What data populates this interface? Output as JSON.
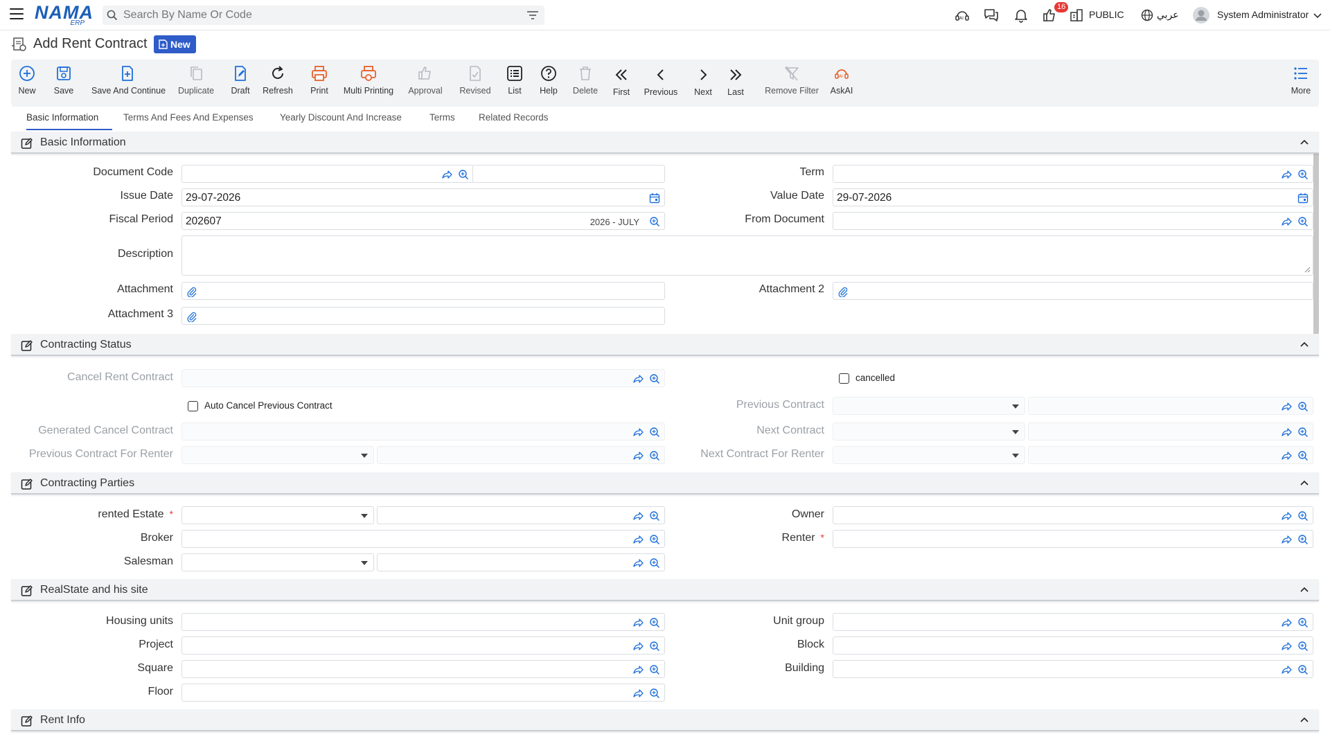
{
  "topbar": {
    "logo_main": "NAMA",
    "logo_sub": "ERP",
    "search_placeholder": "Search By Name Or Code",
    "notifications_count": "16",
    "branch": "PUBLIC",
    "language": "عربي",
    "user": "System Administrator"
  },
  "page": {
    "title": "Add Rent Contract",
    "status_badge": "New"
  },
  "toolbar": {
    "new": "New",
    "save": "Save",
    "save_continue": "Save And Continue",
    "duplicate": "Duplicate",
    "draft": "Draft",
    "refresh": "Refresh",
    "print": "Print",
    "multi_printing": "Multi Printing",
    "approval": "Approval",
    "revised": "Revised",
    "list": "List",
    "help": "Help",
    "delete": "Delete",
    "first": "First",
    "previous": "Previous",
    "next": "Next",
    "last": "Last",
    "remove_filter": "Remove Filter",
    "askai": "AskAI",
    "more": "More"
  },
  "tabs": {
    "basic": "Basic Information",
    "terms_fees": "Terms And Fees And Expenses",
    "yearly": "Yearly Discount And Increase",
    "terms": "Terms",
    "related": "Related Records"
  },
  "basic": {
    "title": "Basic Information",
    "document_code": "Document Code",
    "term": "Term",
    "issue_date": "Issue Date",
    "issue_date_value": "29-07-2026",
    "value_date": "Value Date",
    "value_date_value": "29-07-2026",
    "fiscal_period": "Fiscal Period",
    "fiscal_period_value": "202607",
    "fiscal_period_name": "2026 - JULY",
    "from_document": "From Document",
    "description": "Description",
    "attachment": "Attachment",
    "attachment2": "Attachment 2",
    "attachment3": "Attachment 3"
  },
  "status": {
    "title": "Contracting Status",
    "cancel_rent_contract": "Cancel Rent Contract",
    "cancelled": "cancelled",
    "auto_cancel": "Auto Cancel Previous Contract",
    "previous_contract": "Previous Contract",
    "generated_cancel": "Generated Cancel Contract",
    "next_contract": "Next Contract",
    "prev_for_renter": "Previous Contract For Renter",
    "next_for_renter": "Next Contract For Renter"
  },
  "parties": {
    "title": "Contracting Parties",
    "rented_estate": "rented Estate",
    "owner": "Owner",
    "broker": "Broker",
    "renter": "Renter",
    "salesman": "Salesman",
    "required_mark": "*"
  },
  "realstate": {
    "title": "RealState and his site",
    "housing_units": "Housing units",
    "unit_group": "Unit group",
    "project": "Project",
    "block": "Block",
    "square": "Square",
    "building": "Building",
    "floor": "Floor"
  },
  "rentinfo": {
    "title": "Rent Info"
  },
  "colors": {
    "accent": "#2f5cc8",
    "icon_blue": "#1e6fd9",
    "print_orange": "#e8612c",
    "required": "#e53935"
  }
}
